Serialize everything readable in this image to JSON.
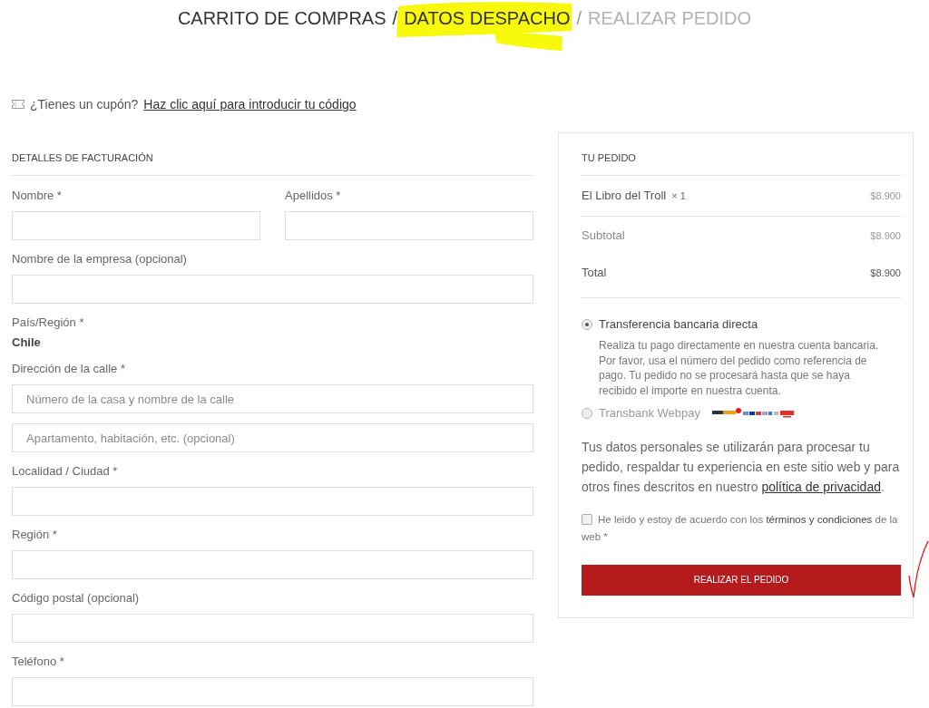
{
  "breadcrumb": [
    {
      "kind": "step",
      "text": "CARRITO DE COMPRAS",
      "active": true,
      "highlighted": false
    },
    {
      "kind": "separator",
      "text": "/",
      "active": true
    },
    {
      "kind": "step",
      "text": "DATOS DESPACHO",
      "active": true,
      "highlighted": true
    },
    {
      "kind": "separator",
      "text": "/",
      "active": false
    },
    {
      "kind": "step",
      "text": "REALIZAR PEDIDO",
      "active": false,
      "highlighted": false
    }
  ],
  "coupon": {
    "question": "¿Tienes un cupón?",
    "link": "Haz clic aquí para introducir tu código"
  },
  "billing": {
    "title": "DETALLES DE FACTURACIÓN",
    "rows": [
      {
        "kind": "pair",
        "fields": [
          {
            "label": "Nombre *"
          },
          {
            "label": "Apellidos *"
          }
        ]
      },
      {
        "kind": "input",
        "label": "Nombre de la empresa (opcional)"
      },
      {
        "kind": "static",
        "label": "País/Región *",
        "value": "Chile"
      },
      {
        "kind": "input",
        "label": "Dirección de la calle *",
        "placeholders": [
          "Número de la casa y nombre de la calle",
          "Apartamento, habitación, etc. (opcional)"
        ]
      },
      {
        "kind": "input",
        "label": "Localidad / Ciudad *"
      },
      {
        "kind": "input",
        "label": "Región *"
      },
      {
        "kind": "input",
        "label": "Código postal (opcional)"
      },
      {
        "kind": "input",
        "label": "Teléfono *"
      }
    ]
  },
  "order": {
    "title": "TU PEDIDO",
    "items": [
      {
        "name": "El Libro del Troll",
        "quantity": "× 1",
        "price": "$8.900"
      }
    ],
    "totals": [
      {
        "kind": "subtotal",
        "label": "Subtotal",
        "amount": "$8.900"
      },
      {
        "kind": "total",
        "label": "Total",
        "amount": "$8.900"
      }
    ],
    "payment_methods": [
      {
        "label": "Transferencia bancaria directa",
        "selected": true,
        "description": "Realiza tu pago directamente en nuestra cuenta bancaria. Por favor, usa el número del pedido como referencia de pago. Tu pedido no se procesará hasta que se haya recibido el importe en nuestra cuenta."
      },
      {
        "label": "Transbank Webpay",
        "selected": false,
        "logos": true
      }
    ],
    "privacy": {
      "text": "Tus datos personales se utilizarán para procesar tu pedido, respaldar tu experiencia en este sitio web y para otros fines descritos en nuestro",
      "link": "política de privacidad",
      "end": "."
    },
    "terms": {
      "checked": false,
      "before": "He leido y estoy de acuerdo con los",
      "link": "términos y condiciones",
      "after": "de la web *"
    },
    "button": "REALIZAR EL PEDIDO"
  },
  "annotations": [
    {
      "kind": "check_mark"
    }
  ]
}
